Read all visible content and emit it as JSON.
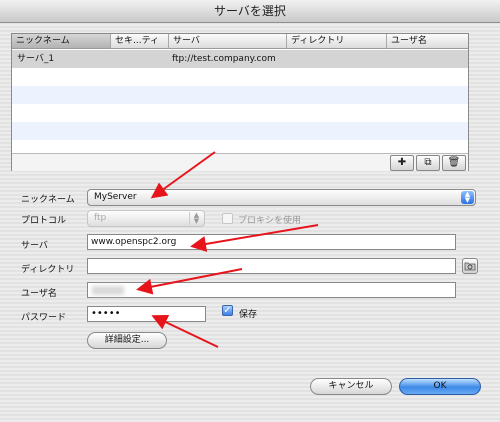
{
  "window": {
    "title": "サーバを選択"
  },
  "table": {
    "columns": [
      "ニックネーム",
      "セキ...ティ",
      "サーバ",
      "ディレクトリ",
      "ユーザ名"
    ],
    "rows": [
      {
        "nickname": "サーバ_1",
        "security": "",
        "server": "ftp://test.company.com",
        "directory": "",
        "user": ""
      }
    ],
    "footer_buttons": {
      "add": "add-icon",
      "duplicate": "duplicate-icon",
      "delete": "trash-icon"
    }
  },
  "form": {
    "nickname_label": "ニックネーム",
    "nickname_value": "MyServer",
    "protocol_label": "プロトコル",
    "protocol_value": "ftp",
    "proxy_label": "プロキシを使用",
    "server_label": "サーバ",
    "server_value": "www.openspc2.org",
    "directory_label": "ディレクトリ",
    "directory_value": "",
    "user_label": "ユーザ名",
    "password_label": "パスワード",
    "password_value": "•••••",
    "save_label": "保存",
    "advanced_label": "詳細設定..."
  },
  "buttons": {
    "cancel": "キャンセル",
    "ok": "OK"
  },
  "colors": {
    "accent": "#3d8ae8",
    "annotation_arrow": "#e8141c",
    "selected_row": "#d4d4d4",
    "alt_row": "#edf3fe"
  }
}
